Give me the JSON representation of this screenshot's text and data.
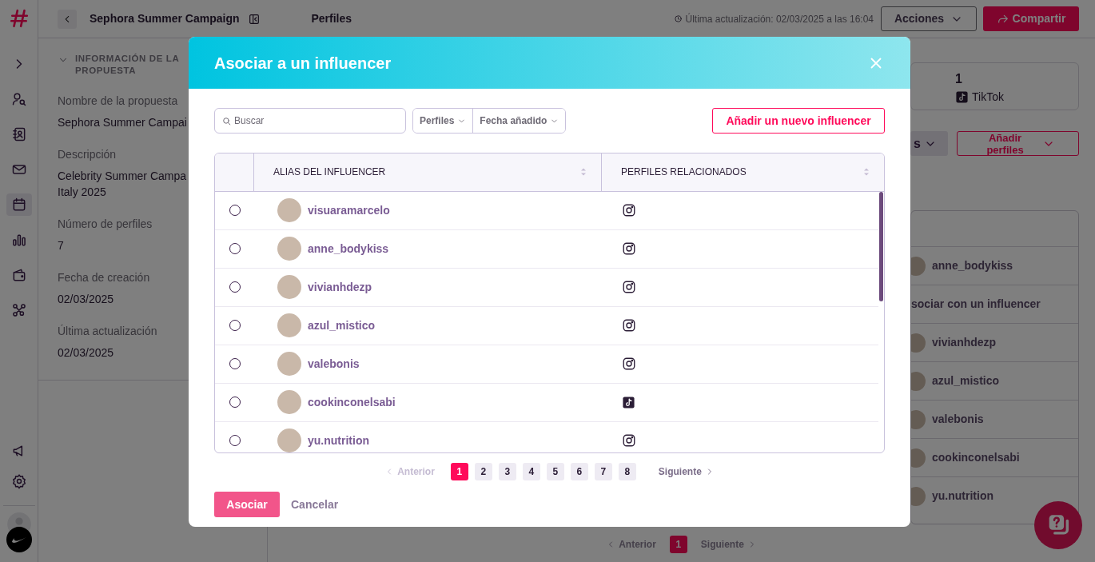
{
  "sidebar": {
    "nav": [
      {
        "kind": "expand",
        "selected": false
      },
      {
        "kind": "user-search",
        "selected": false
      },
      {
        "kind": "contacts",
        "selected": false
      },
      {
        "kind": "mail",
        "selected": false
      },
      {
        "kind": "calendar",
        "selected": true
      },
      {
        "kind": "chart",
        "selected": false
      },
      {
        "kind": "wallet",
        "selected": false
      },
      {
        "kind": "network",
        "selected": false
      }
    ],
    "bottom": [
      {
        "kind": "megaphone"
      },
      {
        "kind": "settings"
      }
    ]
  },
  "header": {
    "title": "Sephora Summer Campaign",
    "section": "Perfiles",
    "last_update": "Última actualización: 02/03/2025 a las 16:04",
    "actions": "Acciones",
    "share": "Compartir"
  },
  "info_panel": {
    "heading": "INFORMACIÓN DE LA PROPUESTA",
    "fields": [
      {
        "label": "Nombre de la propuesta",
        "value": "Sephora Summer Campai"
      },
      {
        "label": "Descripción",
        "value": "Celebrity Summer Campa\nItaly 2025"
      },
      {
        "label": "Número de perfiles",
        "value": "7"
      },
      {
        "label": "Fecha de creación",
        "value": "02/03/2025"
      },
      {
        "label": "Última actualización",
        "value": "02/03/2025"
      }
    ]
  },
  "main": {
    "stats": [
      {
        "value": "1",
        "label": "TikTok"
      }
    ],
    "view_button": "s",
    "add_profiles": "Añadir perfiles",
    "rows": [
      {
        "kind": "profile",
        "text": "anne_bodykiss"
      },
      {
        "kind": "pending",
        "text": "sociar con un influencer"
      },
      {
        "kind": "profile",
        "text": "vivianhdezp"
      },
      {
        "kind": "profile",
        "text": "azul_mistico"
      },
      {
        "kind": "profile",
        "text": "valebonis"
      },
      {
        "kind": "profile",
        "text": "cookinconelsabi"
      },
      {
        "kind": "profile",
        "text": "yu.nutrition"
      }
    ],
    "pagination": {
      "previous": "Anterior",
      "pages": [
        {
          "label": "1",
          "selected": true
        }
      ],
      "next": "Siguiente"
    }
  },
  "modal": {
    "title": "Asociar a un influencer",
    "search": {
      "placeholder": "Buscar"
    },
    "filters": [
      "Perfiles",
      "Fecha añadido"
    ],
    "add_button": "Añadir un nuevo influencer",
    "columns": [
      "ALIAS DEL INFLUENCER",
      "PERFILES RELACIONADOS"
    ],
    "rows": [
      {
        "alias": "visuaramarcelo",
        "selected": false,
        "profiles": [
          {
            "kind": "instagram"
          }
        ]
      },
      {
        "alias": "anne_bodykiss",
        "selected": false,
        "profiles": [
          {
            "kind": "instagram"
          }
        ]
      },
      {
        "alias": "vivianhdezp",
        "selected": false,
        "profiles": [
          {
            "kind": "instagram"
          }
        ]
      },
      {
        "alias": "azul_mistico",
        "selected": false,
        "profiles": [
          {
            "kind": "instagram"
          }
        ]
      },
      {
        "alias": "valebonis",
        "selected": false,
        "profiles": [
          {
            "kind": "instagram"
          }
        ]
      },
      {
        "alias": "cookinconelsabi",
        "selected": false,
        "profiles": [
          {
            "kind": "tiktok"
          }
        ]
      },
      {
        "alias": "yu.nutrition",
        "selected": false,
        "profiles": [
          {
            "kind": "instagram"
          }
        ]
      }
    ],
    "pagination": {
      "previous": "Anterior",
      "previous_disabled": true,
      "pages": [
        {
          "label": "1",
          "selected": true
        },
        {
          "label": "2",
          "selected": false
        },
        {
          "label": "3",
          "selected": false
        },
        {
          "label": "4",
          "selected": false
        },
        {
          "label": "5",
          "selected": false
        },
        {
          "label": "6",
          "selected": false
        },
        {
          "label": "7",
          "selected": false
        },
        {
          "label": "8",
          "selected": false
        }
      ],
      "next": "Siguiente"
    },
    "associate": {
      "label": "Asociar",
      "disabled": true
    },
    "cancel": "Cancelar"
  }
}
